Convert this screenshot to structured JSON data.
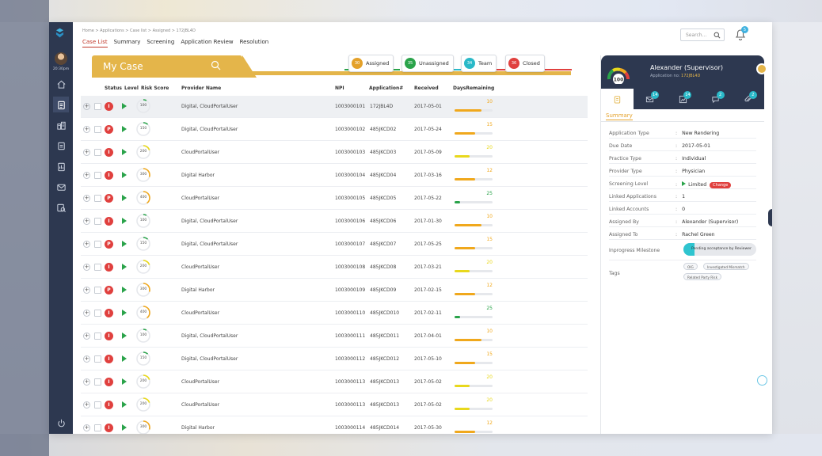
{
  "time": "20:30pm",
  "breadcrumb": "Home > Applications > Case list > Assigned > 172JBL4D",
  "nav_tabs": [
    "Case List",
    "Summary",
    "Screening",
    "Application Review",
    "Resolution"
  ],
  "search_placeholder": "Search...",
  "bell_badge": "5",
  "my_case_title": "My Case",
  "status_tabs": [
    {
      "label": "Assigned",
      "count": "30",
      "color": "#e4a12a"
    },
    {
      "label": "Unassigned",
      "count": "35",
      "color": "#2aa34a"
    },
    {
      "label": "Team",
      "count": "34",
      "color": "#2ab9c8"
    },
    {
      "label": "Closed",
      "count": "36",
      "color": "#e0403e"
    }
  ],
  "table_headers": {
    "status": "Status",
    "level": "Level",
    "risk": "Risk Score",
    "provider": "Provider Name",
    "npi": "NPI",
    "app": "Application#",
    "received": "Received",
    "days": "DaysRemaining"
  },
  "rows": [
    {
      "status": "I",
      "score": "100",
      "provider": "Digital, CloudPortalUser",
      "npi": "1003000101",
      "app": "172JBL4D",
      "received": "2017-05-01",
      "days": "10",
      "pct": 0.7,
      "color": "#f0a81c"
    },
    {
      "status": "P",
      "score": "150",
      "provider": "Digital, CloudPortalUser",
      "npi": "1003000102",
      "app": "485JKCD02",
      "received": "2017-05-24",
      "days": "15",
      "pct": 0.55,
      "color": "#f0a81c"
    },
    {
      "status": "I",
      "score": "200",
      "provider": "CloudPortalUser",
      "npi": "1003000103",
      "app": "485JKCD03",
      "received": "2017-05-09",
      "days": "20",
      "pct": 0.4,
      "color": "#e8d81c"
    },
    {
      "status": "I",
      "score": "300",
      "provider": "Digital Harbor",
      "npi": "1003000104",
      "app": "485JKCD04",
      "received": "2017-03-16",
      "days": "12",
      "pct": 0.55,
      "color": "#f0a81c"
    },
    {
      "status": "P",
      "score": "400",
      "provider": "CloudPortalUser",
      "npi": "1003000105",
      "app": "485JKCD05",
      "received": "2017-05-22",
      "days": "25",
      "pct": 0.15,
      "color": "#2aa34a"
    },
    {
      "status": "I",
      "score": "100",
      "provider": "Digital, CloudPortalUser",
      "npi": "1003000106",
      "app": "485JKCD06",
      "received": "2017-01-30",
      "days": "10",
      "pct": 0.7,
      "color": "#f0a81c"
    },
    {
      "status": "P",
      "score": "150",
      "provider": "Digital, CloudPortalUser",
      "npi": "1003000107",
      "app": "485JKCD07",
      "received": "2017-05-25",
      "days": "15",
      "pct": 0.55,
      "color": "#f0a81c"
    },
    {
      "status": "I",
      "score": "200",
      "provider": "CloudPortalUser",
      "npi": "1003000108",
      "app": "485JKCD08",
      "received": "2017-03-21",
      "days": "20",
      "pct": 0.4,
      "color": "#e8d81c"
    },
    {
      "status": "P",
      "score": "300",
      "provider": "Digital Harbor",
      "npi": "1003000109",
      "app": "485JKCD09",
      "received": "2017-02-15",
      "days": "12",
      "pct": 0.55,
      "color": "#f0a81c"
    },
    {
      "status": "I",
      "score": "400",
      "provider": "CloudPortalUser",
      "npi": "1003000110",
      "app": "485JKCD010",
      "received": "2017-02-11",
      "days": "25",
      "pct": 0.15,
      "color": "#2aa34a"
    },
    {
      "status": "I",
      "score": "100",
      "provider": "Digital, CloudPortalUser",
      "npi": "1003000111",
      "app": "485JKCD011",
      "received": "2017-04-01",
      "days": "10",
      "pct": 0.7,
      "color": "#f0a81c"
    },
    {
      "status": "I",
      "score": "150",
      "provider": "Digital, CloudPortalUser",
      "npi": "1003000112",
      "app": "485JKCD012",
      "received": "2017-05-10",
      "days": "15",
      "pct": 0.55,
      "color": "#f0a81c"
    },
    {
      "status": "I",
      "score": "200",
      "provider": "CloudPortalUser",
      "npi": "1003000113",
      "app": "485JKCD013",
      "received": "2017-05-02",
      "days": "20",
      "pct": 0.4,
      "color": "#e8d81c"
    },
    {
      "status": "I",
      "score": "200",
      "provider": "CloudPortalUser",
      "npi": "1003000113",
      "app": "485JKCD013",
      "received": "2017-05-02",
      "days": "20",
      "pct": 0.4,
      "color": "#e8d81c"
    },
    {
      "status": "I",
      "score": "300",
      "provider": "Digital Harbor",
      "npi": "1003000114",
      "app": "485JKCD014",
      "received": "2017-05-30",
      "days": "12",
      "pct": 0.55,
      "color": "#f0a81c"
    }
  ],
  "panel": {
    "gauge_value": "100",
    "name": "Alexander (Supervisor)",
    "app_label": "Application no:",
    "app_no": "172JBL4D",
    "tab_badges": [
      "14",
      "14",
      "2",
      "2"
    ],
    "summary_label": "Summary",
    "props": [
      {
        "k": "Application Type",
        "v": "New Rendering"
      },
      {
        "k": "Due Date",
        "v": "2017-05-01"
      },
      {
        "k": "Practice Type",
        "v": "Individual"
      },
      {
        "k": "Provider Type",
        "v": "Physician"
      },
      {
        "k": "Screening Level",
        "v": "Limited"
      },
      {
        "k": "Linked Applications",
        "v": "1"
      },
      {
        "k": "Linked Accounts",
        "v": "0"
      },
      {
        "k": "Assigned By",
        "v": "Alexander (Supervisor)"
      },
      {
        "k": "Assigned To",
        "v": "Rachel Green"
      }
    ],
    "change_label": "Change",
    "milestone_label": "Inprogress Milestone",
    "milestone_text": "Pending acceptance by Reviewer",
    "tags_label": "Tags",
    "tags": [
      "OIG",
      "Investigated Mismatch",
      "Related Party Risk"
    ]
  }
}
